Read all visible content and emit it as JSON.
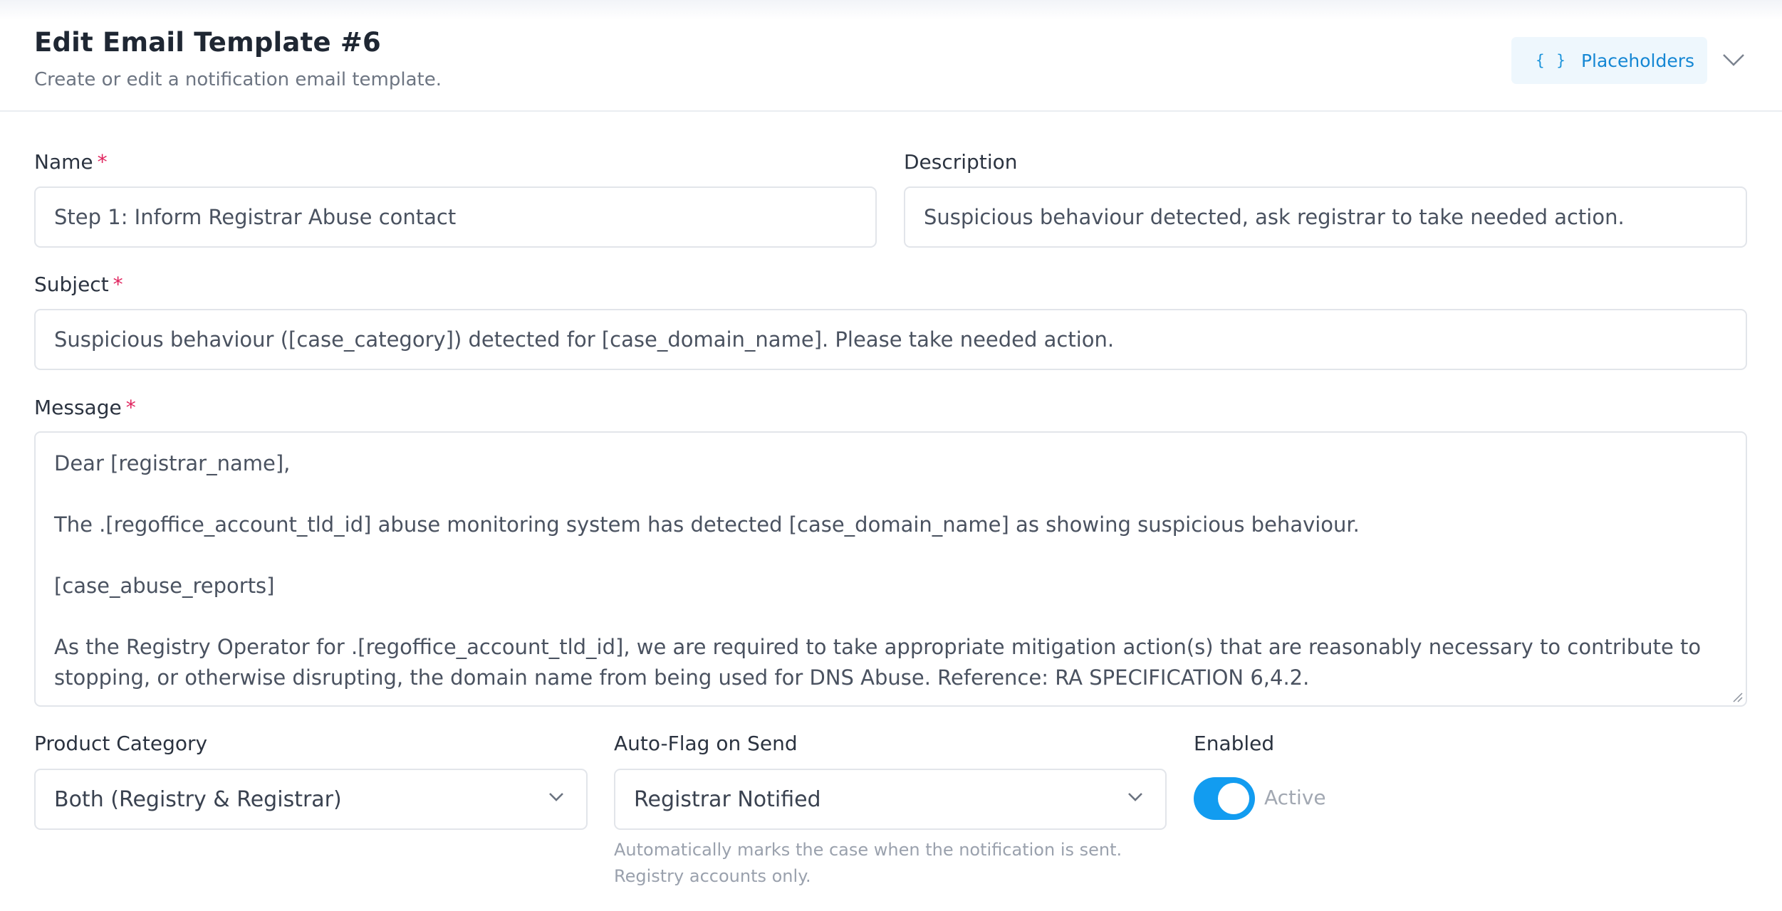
{
  "header": {
    "title": "Edit Email Template #6",
    "subtitle": "Create or edit a notification email template.",
    "placeholders_icon": "{ }",
    "placeholders_label": "Placeholders",
    "collapse_icon": "chevron-down-icon"
  },
  "form": {
    "name": {
      "label": "Name",
      "required_mark": "*",
      "value": "Step 1: Inform Registrar Abuse contact"
    },
    "description": {
      "label": "Description",
      "value": "Suspicious behaviour detected, ask registrar to take needed action."
    },
    "subject": {
      "label": "Subject",
      "required_mark": "*",
      "value": "Suspicious behaviour ([case_category]) detected for [case_domain_name]. Please take needed action."
    },
    "message": {
      "label": "Message",
      "required_mark": "*",
      "lines": [
        "Dear [registrar_name],",
        "The .[regoffice_account_tld_id] abuse monitoring system has detected [case_domain_name] as showing suspicious behaviour.",
        "[case_abuse_reports]",
        "As the Registry Operator for .[regoffice_account_tld_id], we are required to take appropriate mitigation action(s) that are reasonably necessary to contribute to stopping, or otherwise disrupting, the domain name from being used for DNS Abuse. Reference: RA SPECIFICATION 6,4.2."
      ]
    },
    "product_category": {
      "label": "Product Category",
      "selected": "Both (Registry & Registrar)"
    },
    "auto_flag": {
      "label": "Auto-Flag on Send",
      "selected": "Registrar Notified",
      "help_line1": "Automatically marks the case when the notification is sent.",
      "help_line2": "Registry accounts only."
    },
    "enabled": {
      "label": "Enabled",
      "state_label": "Active",
      "on": true
    }
  },
  "colors": {
    "accent": "#129cf0",
    "required": "#e0245e",
    "placeholders_bg": "#eef7fd",
    "border": "#e2e5ea"
  }
}
